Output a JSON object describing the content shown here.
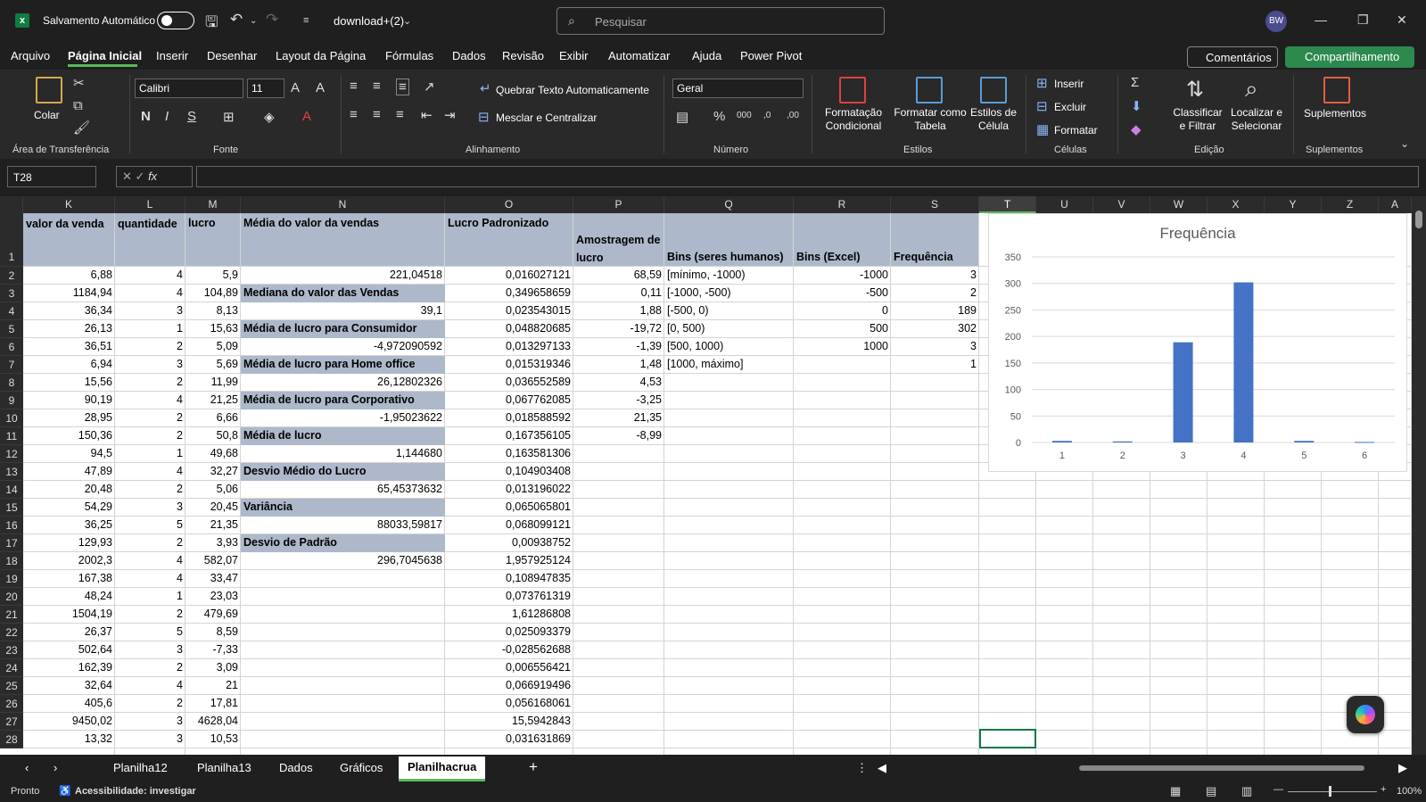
{
  "titlebar": {
    "autosave_label": "Salvamento Automático",
    "doc_title": "download+(2)",
    "search_placeholder": "Pesquisar",
    "avatar": "BW"
  },
  "menu": {
    "items": [
      "Arquivo",
      "Página Inicial",
      "Inserir",
      "Desenhar",
      "Layout da Página",
      "Fórmulas",
      "Dados",
      "Revisão",
      "Exibir",
      "Automatizar",
      "Ajuda",
      "Power Pivot"
    ],
    "comments": "Comentários",
    "share": "Compartilhamento"
  },
  "ribbon": {
    "paste": "Colar",
    "clipboard_group": "Área de Transferência",
    "font_name": "Calibri",
    "font_size": "11",
    "font_group": "Fonte",
    "wrap_text": "Quebrar Texto Automaticamente",
    "merge_center": "Mesclar e Centralizar",
    "align_group": "Alinhamento",
    "number_format": "Geral",
    "number_group": "Número",
    "cond_format": "Formatação Condicional",
    "format_table": "Formatar como Tabela",
    "cell_styles": "Estilos de Célula",
    "styles_group": "Estilos",
    "insert": "Inserir",
    "delete": "Excluir",
    "format": "Formatar",
    "cells_group": "Células",
    "sort_filter": "Classificar e Filtrar",
    "find_select": "Localizar e Selecionar",
    "edit_group": "Edição",
    "addins": "Suplementos",
    "addins_group": "Suplementos"
  },
  "formula_bar": {
    "name_box": "T28",
    "value": ""
  },
  "columns": [
    "K",
    "L",
    "M",
    "N",
    "O",
    "P",
    "Q",
    "R",
    "S",
    "T",
    "U",
    "V",
    "W",
    "X",
    "Y",
    "Z",
    "A"
  ],
  "header_row": {
    "K": "valor da venda",
    "L": "quantidade",
    "M": "lucro",
    "N": "Média do  valor  da vendas",
    "O": "Lucro Padronizado",
    "P": "Amostragem de  lucro",
    "Q": "Bins (seres humanos)",
    "R": "Bins (Excel)",
    "S": "Frequência"
  },
  "rows": [
    {
      "n": "2",
      "K": "6,88",
      "L": "4",
      "M": "5,9",
      "N": "221,04518",
      "O": "0,016027121",
      "P": "68,59",
      "Q": "[mínimo, -1000)",
      "R": "-1000",
      "S": "3"
    },
    {
      "n": "3",
      "K": "1184,94",
      "L": "4",
      "M": "104,89",
      "N": "Mediana do  valor  das  Vendas",
      "O": "0,349658659",
      "P": "0,11",
      "Q": "[-1000, -500)",
      "R": "-500",
      "S": "2"
    },
    {
      "n": "4",
      "K": "36,34",
      "L": "3",
      "M": "8,13",
      "N": "39,1",
      "O": "0,023543015",
      "P": "1,88",
      "Q": "[-500, 0)",
      "R": "0",
      "S": "189"
    },
    {
      "n": "5",
      "K": "26,13",
      "L": "1",
      "M": "15,63",
      "N": "Média  de  lucro para Consumidor",
      "O": "0,048820685",
      "P": "-19,72",
      "Q": "[0, 500)",
      "R": "500",
      "S": "302"
    },
    {
      "n": "6",
      "K": "36,51",
      "L": "2",
      "M": "5,09",
      "N": "-4,972090592",
      "O": "0,013297133",
      "P": "-1,39",
      "Q": "[500, 1000)",
      "R": "1000",
      "S": "3"
    },
    {
      "n": "7",
      "K": "6,94",
      "L": "3",
      "M": "5,69",
      "N": "Média  de  lucro para Home office",
      "O": "0,015319346",
      "P": "1,48",
      "Q": "[1000, máximo]",
      "R": "",
      "S": "1"
    },
    {
      "n": "8",
      "K": "15,56",
      "L": "2",
      "M": "11,99",
      "N": "26,12802326",
      "O": "0,036552589",
      "P": "4,53",
      "Q": "",
      "R": "",
      "S": ""
    },
    {
      "n": "9",
      "K": "90,19",
      "L": "4",
      "M": "21,25",
      "N": "Média de  lucro  para  Corporativo",
      "O": "0,067762085",
      "P": "-3,25",
      "Q": "",
      "R": "",
      "S": ""
    },
    {
      "n": "10",
      "K": "28,95",
      "L": "2",
      "M": "6,66",
      "N": "-1,95023622",
      "O": "0,018588592",
      "P": "21,35",
      "Q": "",
      "R": "",
      "S": ""
    },
    {
      "n": "11",
      "K": "150,36",
      "L": "2",
      "M": "50,8",
      "N": "Média de  lucro",
      "O": "0,167356105",
      "P": "-8,99",
      "Q": "",
      "R": "",
      "S": ""
    },
    {
      "n": "12",
      "K": "94,5",
      "L": "1",
      "M": "49,68",
      "N": "1,144680",
      "O": "0,163581306",
      "P": "",
      "Q": "",
      "R": "",
      "S": ""
    },
    {
      "n": "13",
      "K": "47,89",
      "L": "4",
      "M": "32,27",
      "N": "Desvio Médio do  Lucro",
      "O": "0,104903408",
      "P": "",
      "Q": "",
      "R": "",
      "S": ""
    },
    {
      "n": "14",
      "K": "20,48",
      "L": "2",
      "M": "5,06",
      "N": "65,45373632",
      "O": "0,013196022",
      "P": "",
      "Q": "",
      "R": "",
      "S": ""
    },
    {
      "n": "15",
      "K": "54,29",
      "L": "3",
      "M": "20,45",
      "N": "Variância",
      "O": "0,065065801",
      "P": "",
      "Q": "",
      "R": "",
      "S": ""
    },
    {
      "n": "16",
      "K": "36,25",
      "L": "5",
      "M": "21,35",
      "N": "88033,59817",
      "O": "0,068099121",
      "P": "",
      "Q": "",
      "R": "",
      "S": ""
    },
    {
      "n": "17",
      "K": "129,93",
      "L": "2",
      "M": "3,93",
      "N": "Desvio de Padrão",
      "O": "0,00938752",
      "P": "",
      "Q": "",
      "R": "",
      "S": ""
    },
    {
      "n": "18",
      "K": "2002,3",
      "L": "4",
      "M": "582,07",
      "N": "296,7045638",
      "O": "1,957925124",
      "P": "",
      "Q": "",
      "R": "",
      "S": ""
    },
    {
      "n": "19",
      "K": "167,38",
      "L": "4",
      "M": "33,47",
      "N": "",
      "O": "0,108947835",
      "P": "",
      "Q": "",
      "R": "",
      "S": ""
    },
    {
      "n": "20",
      "K": "48,24",
      "L": "1",
      "M": "23,03",
      "N": "",
      "O": "0,073761319",
      "P": "",
      "Q": "",
      "R": "",
      "S": ""
    },
    {
      "n": "21",
      "K": "1504,19",
      "L": "2",
      "M": "479,69",
      "N": "",
      "O": "1,61286808",
      "P": "",
      "Q": "",
      "R": "",
      "S": ""
    },
    {
      "n": "22",
      "K": "26,37",
      "L": "5",
      "M": "8,59",
      "N": "",
      "O": "0,025093379",
      "P": "",
      "Q": "",
      "R": "",
      "S": ""
    },
    {
      "n": "23",
      "K": "502,64",
      "L": "3",
      "M": "-7,33",
      "N": "",
      "O": "-0,028562688",
      "P": "",
      "Q": "",
      "R": "",
      "S": ""
    },
    {
      "n": "24",
      "K": "162,39",
      "L": "2",
      "M": "3,09",
      "N": "",
      "O": "0,006556421",
      "P": "",
      "Q": "",
      "R": "",
      "S": ""
    },
    {
      "n": "25",
      "K": "32,64",
      "L": "4",
      "M": "21",
      "N": "",
      "O": "0,066919496",
      "P": "",
      "Q": "",
      "R": "",
      "S": ""
    },
    {
      "n": "26",
      "K": "405,6",
      "L": "2",
      "M": "17,81",
      "N": "",
      "O": "0,056168061",
      "P": "",
      "Q": "",
      "R": "",
      "S": ""
    },
    {
      "n": "27",
      "K": "9450,02",
      "L": "3",
      "M": "4628,04",
      "N": "",
      "O": "15,5942843",
      "P": "",
      "Q": "",
      "R": "",
      "S": ""
    },
    {
      "n": "28",
      "K": "13,32",
      "L": "3",
      "M": "10,53",
      "N": "",
      "O": "0,031631869",
      "P": "",
      "Q": "",
      "R": "",
      "S": ""
    }
  ],
  "chart_data": {
    "type": "bar",
    "title": "Frequência",
    "categories": [
      "1",
      "2",
      "3",
      "4",
      "5",
      "6"
    ],
    "values": [
      3,
      2,
      189,
      302,
      3,
      1
    ],
    "ylim": [
      0,
      350
    ],
    "yticks": [
      "0",
      "50",
      "100",
      "150",
      "200",
      "250",
      "300",
      "350"
    ],
    "grid": true,
    "color": "#4472c4"
  },
  "sheets": [
    "Planilha12",
    "Planilha13",
    "Dados",
    "Gráficos",
    "Planilhacrua"
  ],
  "active_sheet": "Planilhacrua",
  "status": {
    "ready": "Pronto",
    "accessibility": "Acessibilidade: investigar",
    "zoom": "100%"
  }
}
